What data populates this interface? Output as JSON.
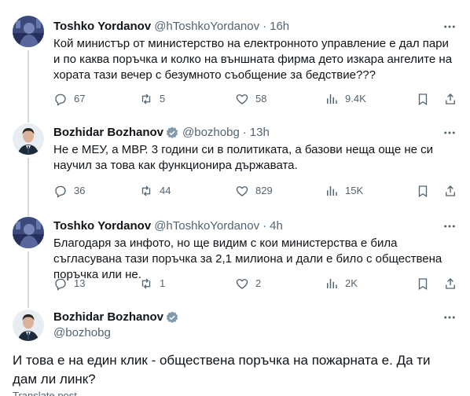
{
  "colors": {
    "text": "#0f1419",
    "secondary": "#536471",
    "verified": "#829aab",
    "thread_line": "#cfd9de"
  },
  "tweets": [
    {
      "name": "Toshko Yordanov",
      "handle": "@hToshkoYordanov",
      "dot": "·",
      "time": "16h",
      "text": "Кой министър от министерство на електронното управление е дал пари и по каква поръчка и колко на външната фирма дето изкара ангелите на хората тази вечер с безумното съобщение за бедствие???",
      "replies": "67",
      "reposts": "5",
      "likes": "58",
      "views": "9.4K"
    },
    {
      "name": "Bozhidar Bozhanov",
      "handle": "@bozhobg",
      "dot": "·",
      "time": "13h",
      "text": "Не е МЕУ, а МВР. 3 години си в политиката, а базови неща още не си научил за това как функционира държавата.",
      "replies": "36",
      "reposts": "44",
      "likes": "829",
      "views": "15K",
      "verified": true
    },
    {
      "name": "Toshko Yordanov",
      "handle": "@hToshkoYordanov",
      "dot": "·",
      "time": "4h",
      "text": "Благодаря за инфото, но ще видим с кои министерства е била съгласувана тази поръчка за 2,1 милиона и дали е било с обществена поръчка или не.",
      "replies": "13",
      "reposts": "1",
      "likes": "2",
      "views": "2K"
    }
  ],
  "main_tweet": {
    "name": "Bozhidar Bozhanov",
    "handle": "@bozhobg",
    "text": "И това е на един клик - обществена поръчка на пожарната е. Да ти дам ли линк?",
    "verified": true,
    "cut_text": "Translate post"
  },
  "icons": {
    "more": "more-icon",
    "reply": "reply-icon",
    "repost": "repost-icon",
    "like": "heart-icon",
    "views": "views-icon",
    "bookmark": "bookmark-icon",
    "share": "share-icon",
    "verified": "verified-badge-icon"
  }
}
